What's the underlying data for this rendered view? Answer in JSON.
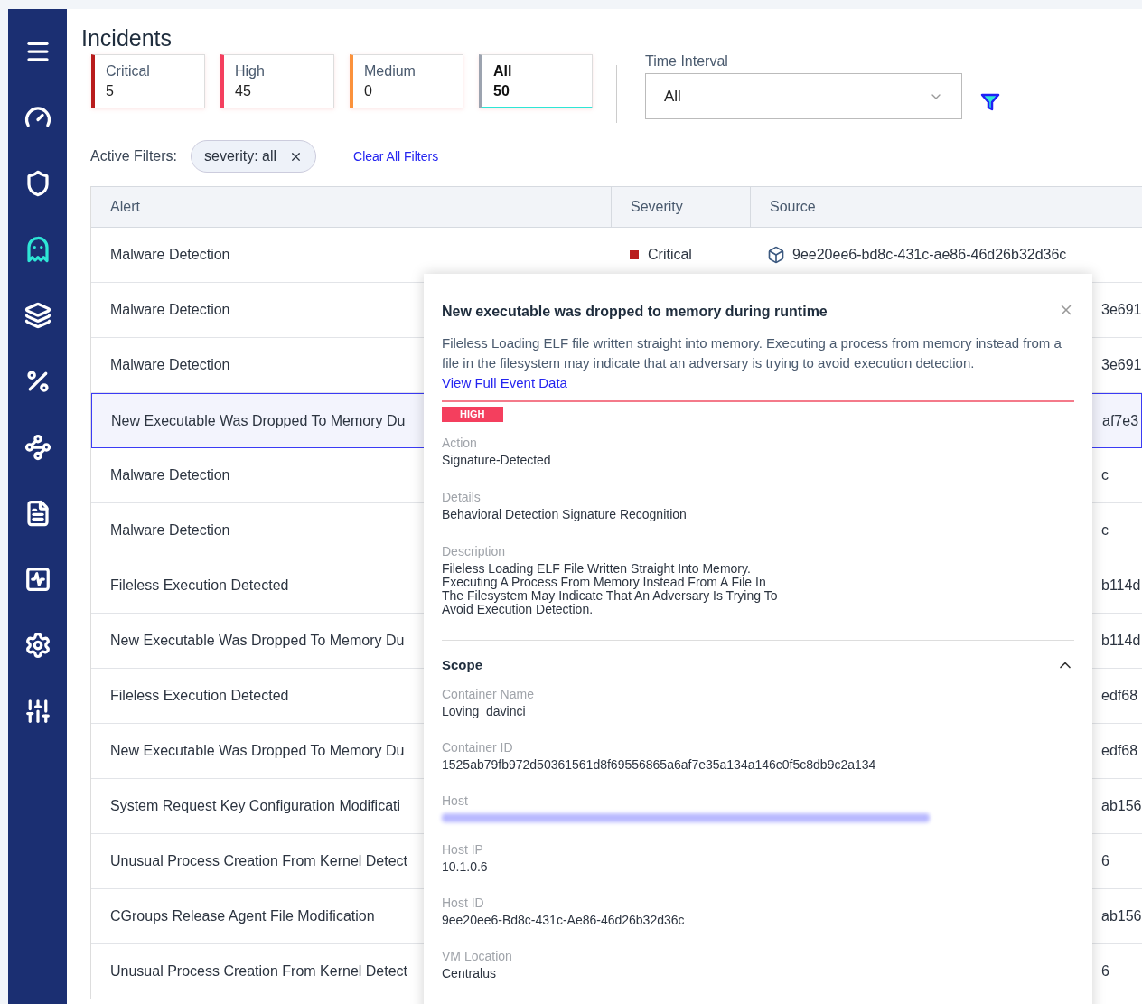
{
  "sidebar": {
    "items": [
      {
        "kind": "menu",
        "selected": false
      },
      {
        "kind": "gauge",
        "selected": false
      },
      {
        "kind": "shield",
        "selected": false
      },
      {
        "kind": "ghost",
        "selected": true
      },
      {
        "kind": "layers",
        "selected": false
      },
      {
        "kind": "percent",
        "selected": false
      },
      {
        "kind": "swirl",
        "selected": false
      },
      {
        "kind": "document",
        "selected": false
      },
      {
        "kind": "chart",
        "selected": false
      },
      {
        "kind": "settings",
        "selected": false
      },
      {
        "kind": "sliders",
        "selected": false
      }
    ]
  },
  "page_title": "Incidents",
  "severity_cards": [
    {
      "label": "Critical",
      "count": "5",
      "color": "#b91c1c",
      "selected": false
    },
    {
      "label": "High",
      "count": "45",
      "color": "#f43f5e",
      "selected": false
    },
    {
      "label": "Medium",
      "count": "0",
      "color": "#fb923c",
      "selected": false
    },
    {
      "label": "All",
      "count": "50",
      "color": "#9ca3af",
      "selected": true
    }
  ],
  "time_interval": {
    "label": "Time Interval",
    "value": "All"
  },
  "active_filters": {
    "label": "Active Filters:",
    "chips": [
      "severity: all"
    ],
    "clear_link": "Clear All Filters"
  },
  "table": {
    "columns": [
      "Alert",
      "Severity",
      "Source"
    ],
    "rows": [
      {
        "alert": "Malware Detection",
        "severity": "Critical",
        "color": "#b91c1c",
        "source": "9ee20ee6-bd8c-431c-ae86-46d26b32d36c",
        "selected": false
      },
      {
        "alert": "Malware Detection",
        "source": "3e691",
        "selected": false
      },
      {
        "alert": "Malware Detection",
        "source": "3e691",
        "selected": false
      },
      {
        "alert": "New Executable Was Dropped To Memory Du",
        "source": "af7e3",
        "selected": true
      },
      {
        "alert": "Malware Detection",
        "source": "c",
        "selected": false
      },
      {
        "alert": "Malware Detection",
        "source": "c",
        "selected": false
      },
      {
        "alert": "Fileless Execution Detected",
        "source": "b114d",
        "selected": false
      },
      {
        "alert": "New Executable Was Dropped To Memory Du",
        "source": "b114d",
        "selected": false
      },
      {
        "alert": "Fileless Execution Detected",
        "source": "edf68",
        "selected": false
      },
      {
        "alert": "New Executable Was Dropped To Memory Du",
        "source": "edf68",
        "selected": false
      },
      {
        "alert": "System Request Key Configuration Modificati",
        "source": "ab156",
        "selected": false
      },
      {
        "alert": "Unusual Process Creation From Kernel Detect",
        "source": "6",
        "selected": false
      },
      {
        "alert": "CGroups Release Agent File Modification",
        "source": "ab156",
        "selected": false
      },
      {
        "alert": "Unusual Process Creation From Kernel Detect",
        "source": "6",
        "selected": false
      }
    ]
  },
  "detail_panel": {
    "title": "New executable was dropped to memory during runtime",
    "summary": "Fileless Loading ELF file written straight into memory. Executing a process from memory instead from a file in the filesystem may indicate that an adversary is trying to avoid execution detection.",
    "link": "View Full Event Data",
    "severity_badge": "HIGH",
    "fields": [
      {
        "label": "Action",
        "value": "Signature-Detected"
      },
      {
        "label": "Details",
        "value": "Behavioral Detection Signature Recognition"
      },
      {
        "label": "Description",
        "value": "Fileless Loading ELF File Written Straight Into Memory.\nExecuting A Process From Memory Instead From A File In\nThe Filesystem May Indicate That An Adversary Is Trying To\nAvoid Execution Detection."
      }
    ],
    "scope": {
      "title": "Scope",
      "expanded": true,
      "fields": [
        {
          "label": "Container Name",
          "value": "Loving_davinci"
        },
        {
          "label": "Container ID",
          "value": "1525ab79fb972d50361561d8f69556865a6af7e35a134a146c0f5c8db9c2a134"
        },
        {
          "label": "Host",
          "redacted": true
        },
        {
          "label": "Host IP",
          "value": "10.1.0.6"
        },
        {
          "label": "Host ID",
          "value": "9ee20ee6-Bd8c-431c-Ae86-46d26b32d36c"
        },
        {
          "label": "VM Location",
          "value": "Centralus"
        }
      ]
    }
  }
}
